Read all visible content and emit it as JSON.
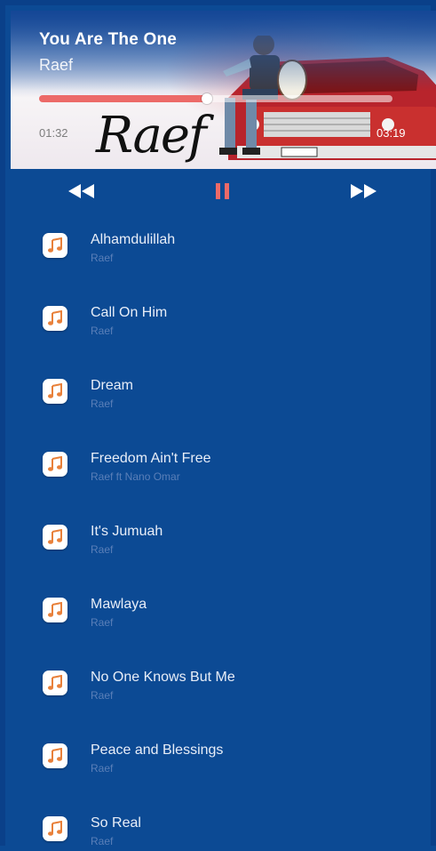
{
  "now_playing": {
    "title": "You Are The One",
    "artist": "Raef",
    "current_time": "01:32",
    "total_time": "03:19",
    "progress": 0.475,
    "album_signature": "Raef"
  },
  "controls": {
    "prev_icon": "rewind-icon",
    "pause_icon": "pause-icon",
    "next_icon": "fast-forward-icon"
  },
  "colors": {
    "background": "#0c4a94",
    "accent": "#ec6a68",
    "icon_orange": "#e8803a"
  },
  "playlist": [
    {
      "title": "Alhamdulillah",
      "artist": "Raef"
    },
    {
      "title": "Call On Him",
      "artist": "Raef"
    },
    {
      "title": "Dream",
      "artist": "Raef"
    },
    {
      "title": "Freedom Ain't Free",
      "artist": "Raef ft Nano Omar"
    },
    {
      "title": "It's Jumuah",
      "artist": "Raef"
    },
    {
      "title": "Mawlaya",
      "artist": "Raef"
    },
    {
      "title": "No One Knows But Me",
      "artist": "Raef"
    },
    {
      "title": "Peace and Blessings",
      "artist": "Raef"
    },
    {
      "title": "So Real",
      "artist": "Raef"
    }
  ]
}
